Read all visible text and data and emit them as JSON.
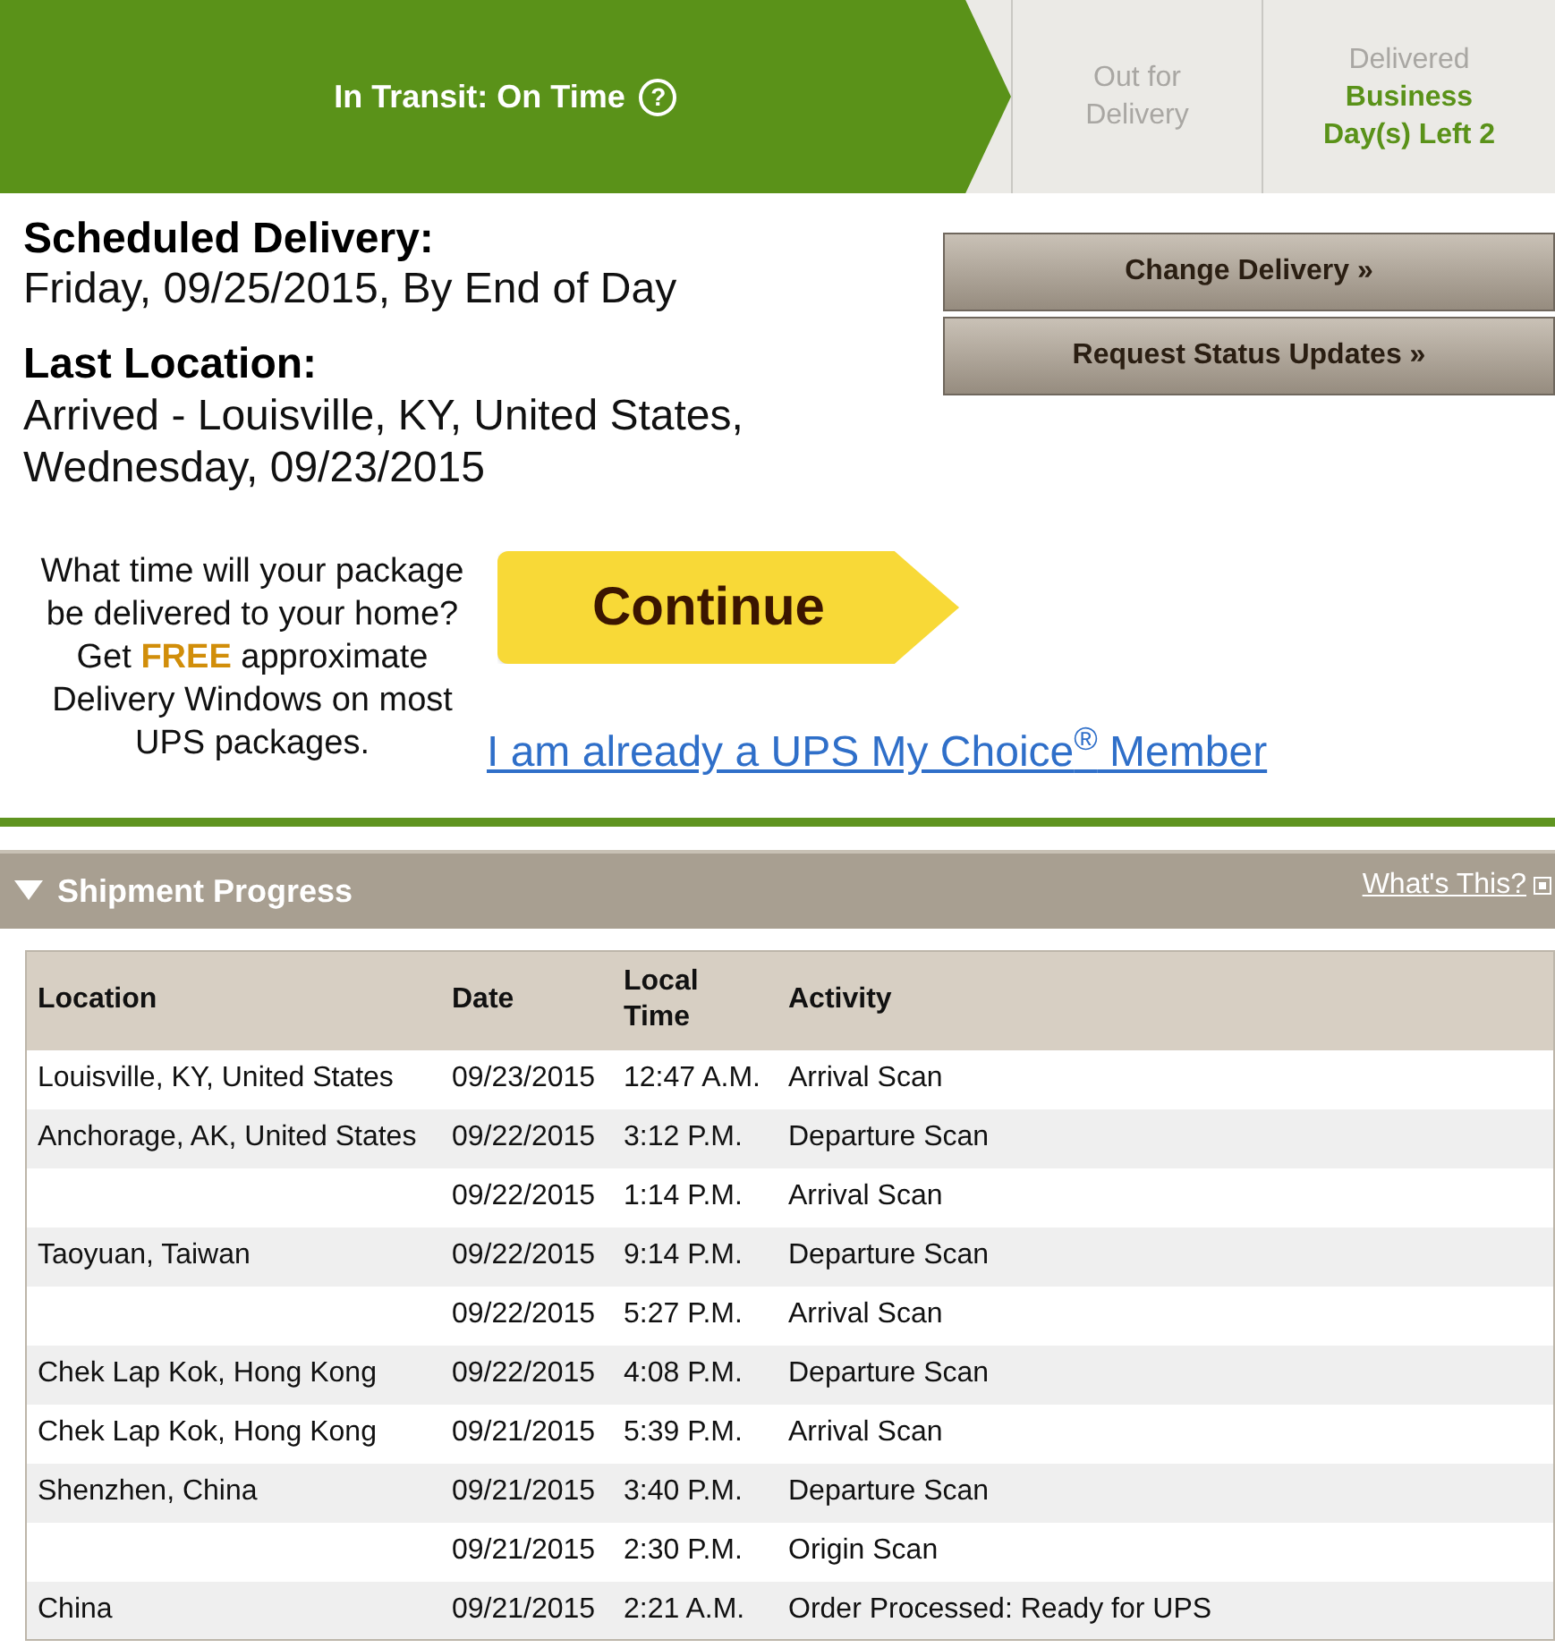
{
  "progress_steps": [
    {
      "label": "In Transit: On Time",
      "selected": true,
      "help": "?"
    },
    {
      "label": "Out for Delivery",
      "selected": false
    },
    {
      "label": "Delivered",
      "selected": false,
      "note": "Business Day(s) Left 2"
    }
  ],
  "scheduled_delivery": {
    "heading": "Scheduled Delivery:",
    "value": "Friday, 09/25/2015, By End of Day"
  },
  "last_location": {
    "heading": "Last Location:",
    "value": "Arrived - Louisville, KY, United States, Wednesday, 09/23/2015"
  },
  "actions": [
    "Change Delivery »",
    "Request Status Updates »"
  ],
  "promo": {
    "text": "What time will your package be delivered to your home? Get **FREE** approximate Delivery Windows on most UPS packages.",
    "button": "Continue",
    "link": "I am already a UPS My Choice$^{®}$ Member"
  },
  "shipment_progress": {
    "title": "Shipment Progress",
    "expanded": true,
    "help_link": "What's This?",
    "columns": [
      "Location",
      "Date",
      "Local Time",
      "Activity"
    ],
    "rows": [
      [
        "Louisville, KY, United States",
        "09/23/2015",
        "12:47 A.M.",
        "Arrival Scan"
      ],
      [
        "Anchorage, AK, United States",
        "09/22/2015",
        "3:12 P.M.",
        "Departure Scan"
      ],
      [
        "",
        "09/22/2015",
        "1:14 P.M.",
        "Arrival Scan"
      ],
      [
        "Taoyuan, Taiwan",
        "09/22/2015",
        "9:14 P.M.",
        "Departure Scan"
      ],
      [
        "",
        "09/22/2015",
        "5:27 P.M.",
        "Arrival Scan"
      ],
      [
        "Chek Lap Kok, Hong Kong",
        "09/22/2015",
        "4:08 P.M.",
        "Departure Scan"
      ],
      [
        "Chek Lap Kok, Hong Kong",
        "09/21/2015",
        "5:39 P.M.",
        "Arrival Scan"
      ],
      [
        "Shenzhen, China",
        "09/21/2015",
        "3:40 P.M.",
        "Departure Scan"
      ],
      [
        "",
        "09/21/2015",
        "2:30 P.M.",
        "Origin Scan"
      ],
      [
        "China",
        "09/21/2015",
        "2:21 A.M.",
        "Order Processed: Ready for UPS"
      ]
    ]
  }
}
